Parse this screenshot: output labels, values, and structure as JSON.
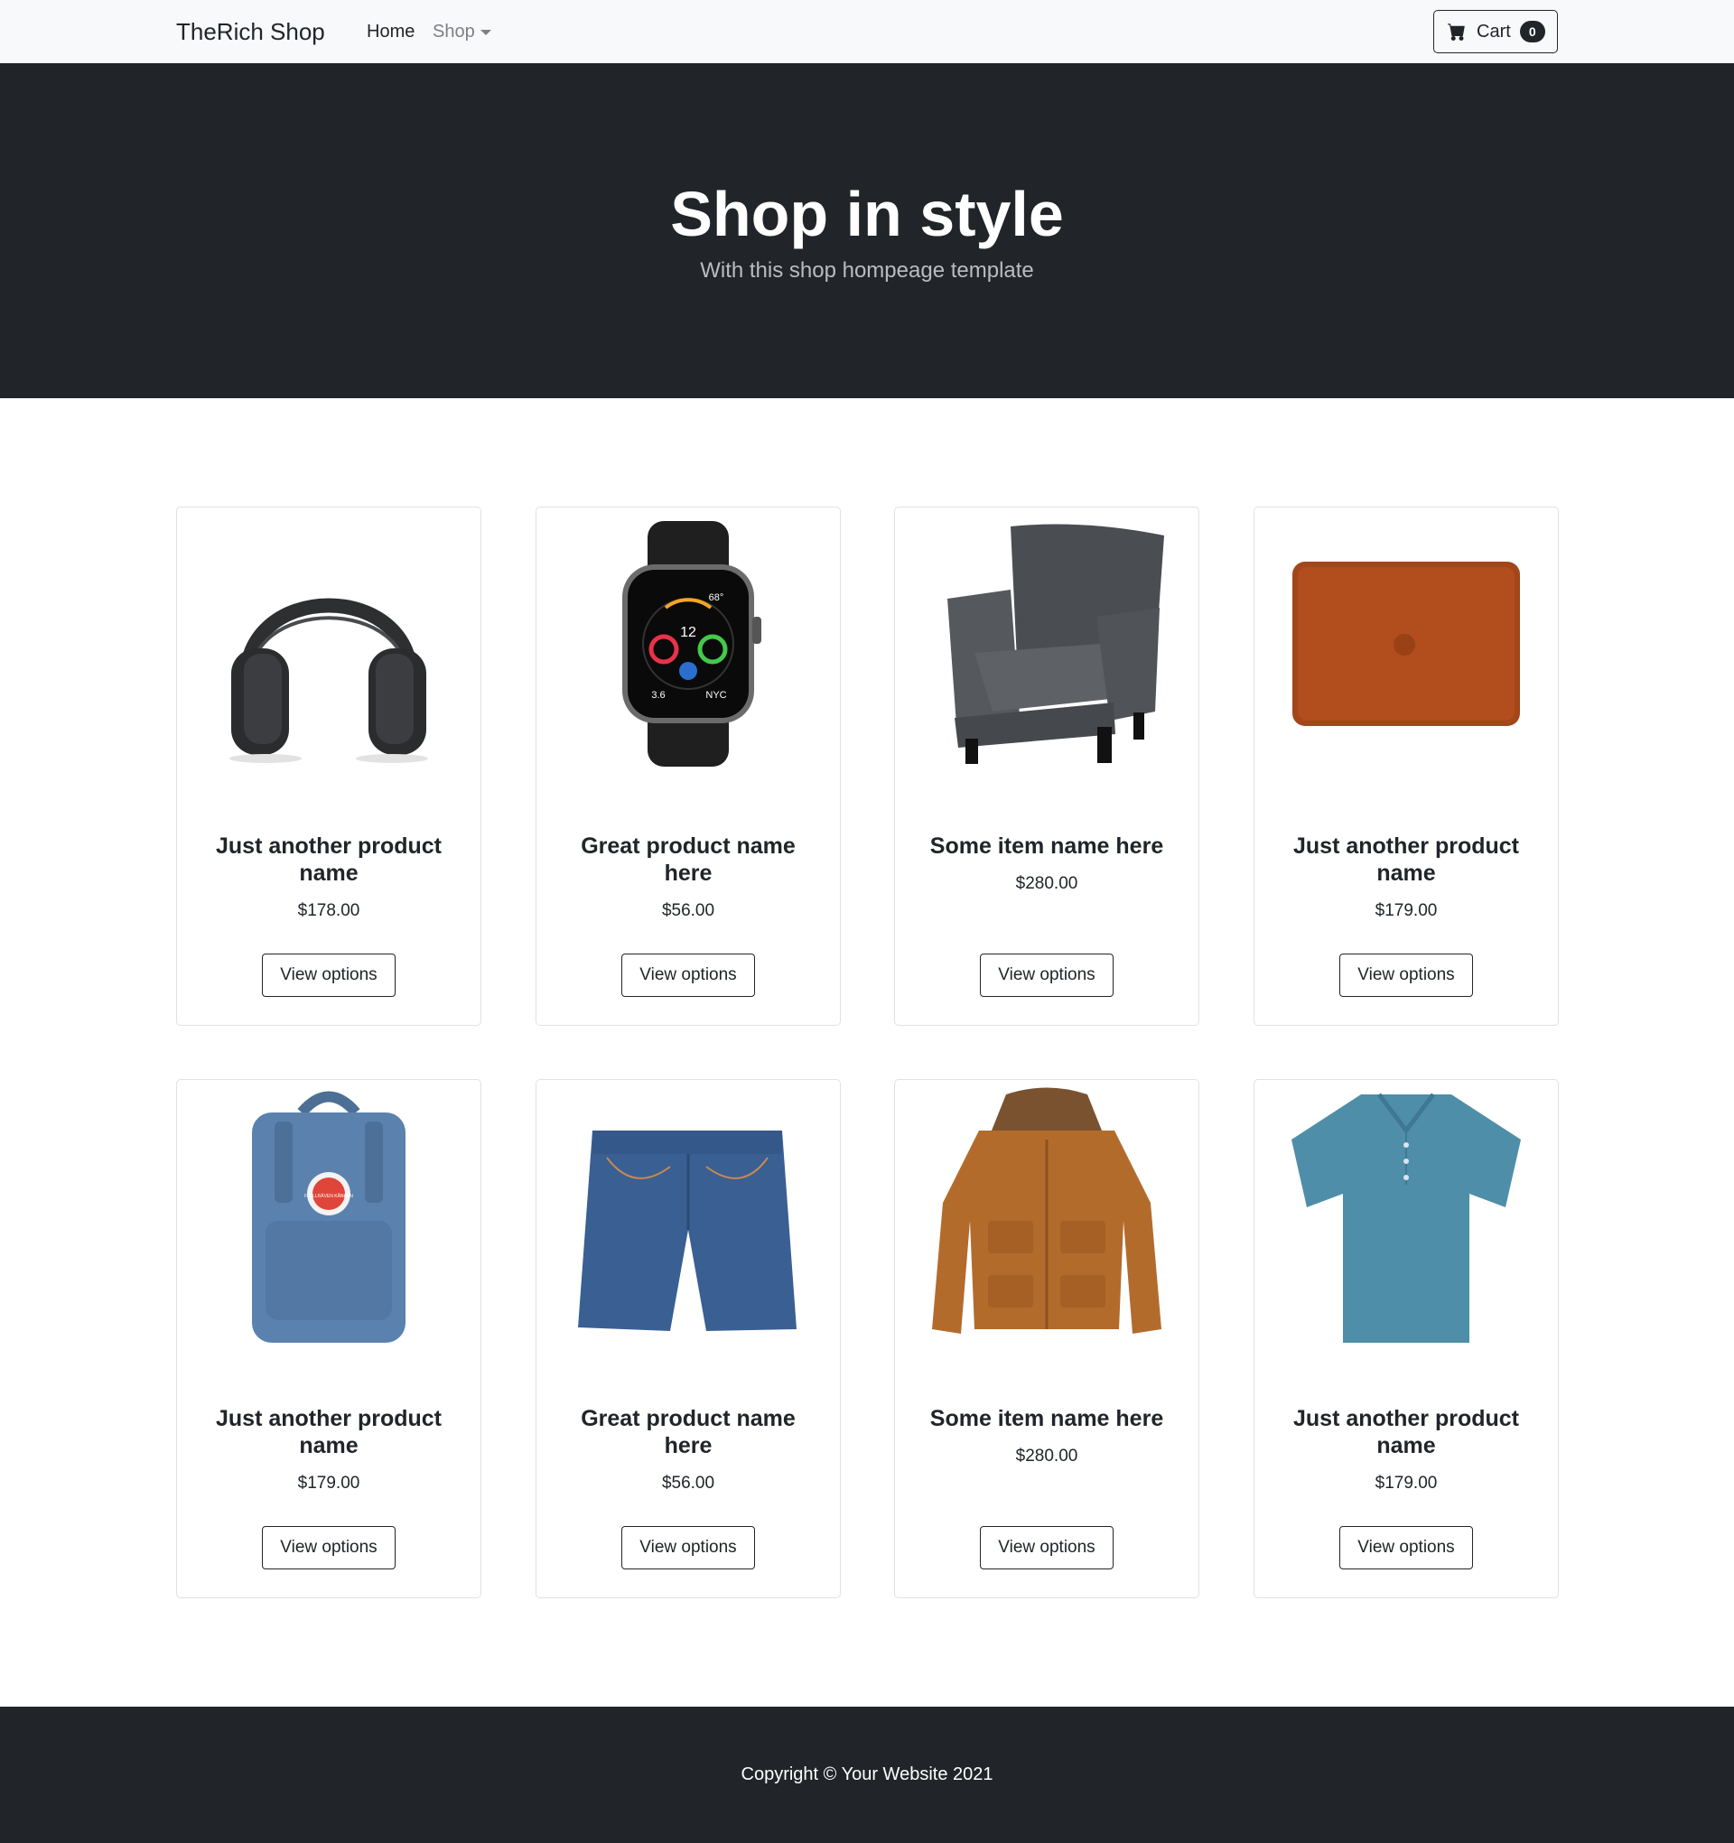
{
  "navbar": {
    "brand": "TheRich Shop",
    "links": {
      "home": "Home",
      "shop": "Shop"
    },
    "cart": {
      "label": "Cart",
      "count": "0"
    }
  },
  "hero": {
    "title": "Shop in style",
    "subtitle": "With this shop hompeage template"
  },
  "products": [
    {
      "name": "Just another product name",
      "price": "$178.00",
      "button": "View options",
      "image": "headphones"
    },
    {
      "name": "Great product name here",
      "price": "$56.00",
      "button": "View options",
      "image": "smartwatch"
    },
    {
      "name": "Some item name here",
      "price": "$280.00",
      "button": "View options",
      "image": "armchair"
    },
    {
      "name": "Just another product name",
      "price": "$179.00",
      "button": "View options",
      "image": "laptop-sleeve"
    },
    {
      "name": "Just another product name",
      "price": "$179.00",
      "button": "View options",
      "image": "backpack"
    },
    {
      "name": "Great product name here",
      "price": "$56.00",
      "button": "View options",
      "image": "denim-shorts"
    },
    {
      "name": "Some item name here",
      "price": "$280.00",
      "button": "View options",
      "image": "jacket"
    },
    {
      "name": "Just another product name",
      "price": "$179.00",
      "button": "View options",
      "image": "polo-shirt"
    }
  ],
  "watch_face": {
    "time": "12",
    "temp": "68°",
    "city": "NYC",
    "stat": "3.6"
  },
  "backpack_logo": "FJÄLLRÄVEN KÅNKEN",
  "footer": {
    "copyright": "Copyright © Your Website 2021"
  },
  "colors": {
    "dark": "#212529",
    "light": "#f8f9fa",
    "border": "#dee2e6"
  }
}
